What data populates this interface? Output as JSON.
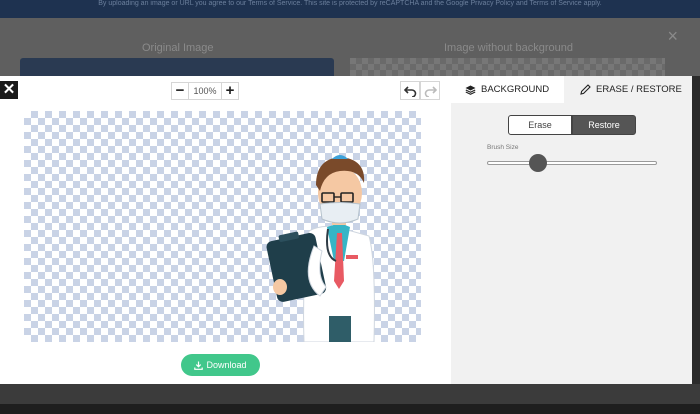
{
  "background_page": {
    "notice": "By uploading an image or URL you agree to our Terms of Service. This site is protected by reCAPTCHA and the Google Privacy Policy and Terms of Service apply.",
    "original_label": "Original Image",
    "result_label": "Image without background",
    "close_glyph": "×"
  },
  "editor": {
    "close_glyph": "✕",
    "zoom": {
      "minus": "−",
      "value": "100%",
      "plus": "+"
    },
    "download_label": "Download"
  },
  "panel": {
    "tabs": [
      {
        "label": "BACKGROUND",
        "icon": "layers-icon",
        "active": false
      },
      {
        "label": "ERASE / RESTORE",
        "icon": "pencil-icon",
        "active": true
      }
    ],
    "mode": {
      "options": [
        "Erase",
        "Restore"
      ],
      "selected": "Restore"
    },
    "brush_label": "Brush Size",
    "brush_size_fraction": 0.3
  },
  "colors": {
    "download": "#41c78b",
    "segment_active": "#555555",
    "checker": "#c9d3e6"
  }
}
